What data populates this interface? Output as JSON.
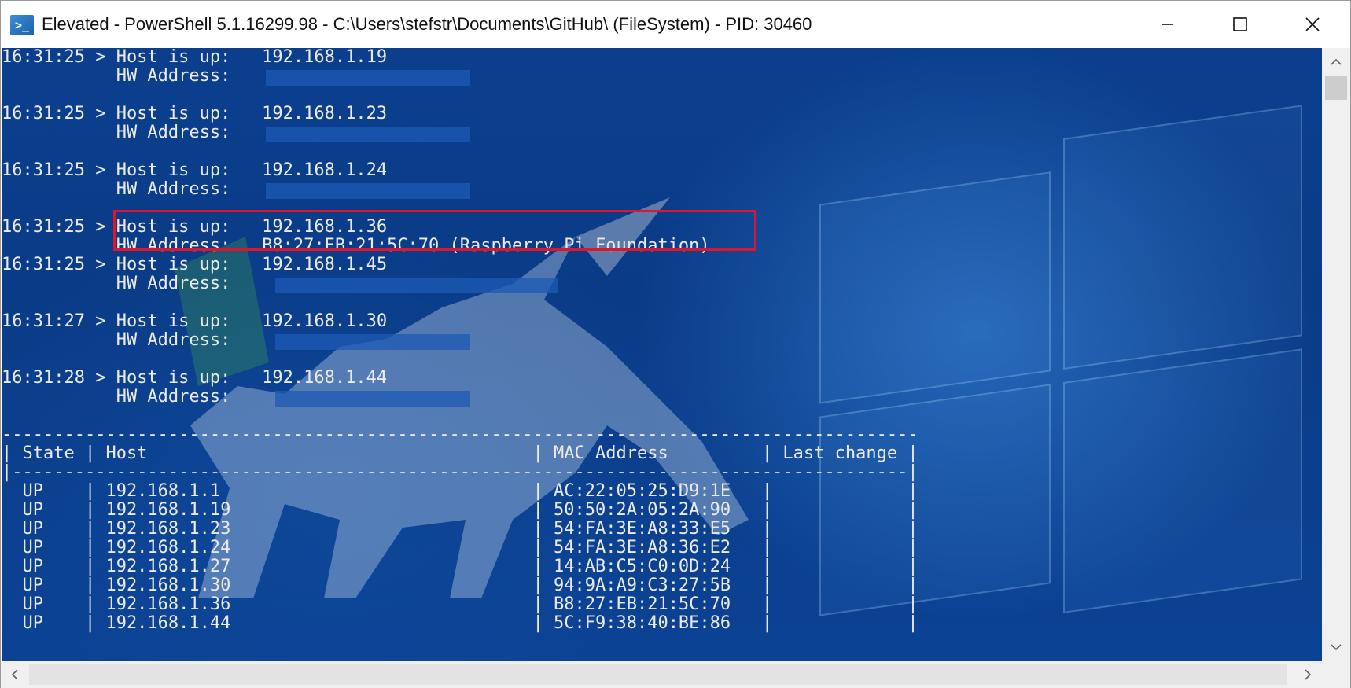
{
  "window": {
    "title": "Elevated - PowerShell 5.1.16299.98 - C:\\Users\\stefstr\\Documents\\GitHub\\ (FileSystem) - PID: 30460",
    "app_icon_glyph": ">_",
    "buttons": {
      "minimize": "minimize",
      "maximize": "maximize",
      "close": "close"
    }
  },
  "console": {
    "text_color": "#eaeaea",
    "highlight_color": "#e0142a",
    "lines": [
      "16:31:25 > Host is up:   192.168.1.19",
      "           HW Address:",
      "",
      "16:31:25 > Host is up:   192.168.1.23",
      "           HW Address:",
      "",
      "16:31:25 > Host is up:   192.168.1.24",
      "           HW Address:",
      "",
      "16:31:25 > Host is up:   192.168.1.36",
      "           HW Address:   B8:27:EB:21:5C:70 (Raspberry Pi Foundation)",
      "16:31:25 > Host is up:   192.168.1.45",
      "           HW Address:",
      "",
      "16:31:27 > Host is up:   192.168.1.30",
      "           HW Address:",
      "",
      "16:31:28 > Host is up:   192.168.1.44",
      "           HW Address:",
      "",
      "----------------------------------------------------------------------------------------",
      "| State | Host                                     | MAC Address         | Last change |",
      "|--------------------------------------------------------------------------------------|",
      "  UP    | 192.168.1.1                              | AC:22:05:25:D9:1E   |             |",
      "  UP    | 192.168.1.19                             | 50:50:2A:05:2A:90   |             |",
      "  UP    | 192.168.1.23                             | 54:FA:3E:A8:33:E5   |             |",
      "  UP    | 192.168.1.24                             | 54:FA:3E:A8:36:E2   |             |",
      "  UP    | 192.168.1.27                             | 14:AB:C5:C0:0D:24   |             |",
      "  UP    | 192.168.1.30                             | 94:9A:A9:C3:27:5B   |             |",
      "  UP    | 192.168.1.36                             | B8:27:EB:21:5C:70   |             |",
      "  UP    | 192.168.1.44                             | 5C:F9:38:40:BE:86   |             |"
    ]
  }
}
